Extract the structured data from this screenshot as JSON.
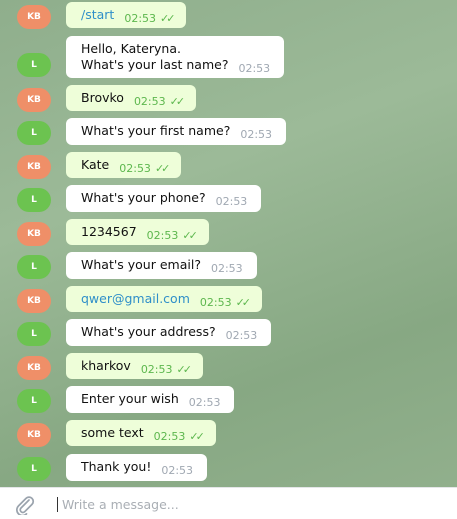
{
  "messages": [
    {
      "from": "user",
      "avatar": "KB",
      "text": "/start",
      "time": "02:53",
      "link": true,
      "ticks": "✓✓"
    },
    {
      "from": "bot",
      "avatar": "L",
      "lines": [
        "Hello, Kateryna.",
        "What's your last name?"
      ],
      "time": "02:53"
    },
    {
      "from": "user",
      "avatar": "KB",
      "text": "Brovko",
      "time": "02:53",
      "ticks": "✓✓"
    },
    {
      "from": "bot",
      "avatar": "L",
      "text": "What's your first name?",
      "time": "02:53"
    },
    {
      "from": "user",
      "avatar": "KB",
      "text": "Kate",
      "time": "02:53",
      "ticks": "✓✓"
    },
    {
      "from": "bot",
      "avatar": "L",
      "text": "What's your phone?",
      "time": "02:53"
    },
    {
      "from": "user",
      "avatar": "KB",
      "text": "1234567",
      "time": "02:53",
      "ticks": "✓✓"
    },
    {
      "from": "bot",
      "avatar": "L",
      "text": "What's your email?",
      "time": "02:53"
    },
    {
      "from": "user",
      "avatar": "KB",
      "text": "qwer@gmail.com",
      "time": "02:53",
      "link": true,
      "ticks": "✓✓"
    },
    {
      "from": "bot",
      "avatar": "L",
      "text": "What's your address?",
      "time": "02:53"
    },
    {
      "from": "user",
      "avatar": "KB",
      "text": "kharkov",
      "time": "02:53",
      "ticks": "✓✓"
    },
    {
      "from": "bot",
      "avatar": "L",
      "text": "Enter your wish",
      "time": "02:53"
    },
    {
      "from": "user",
      "avatar": "KB",
      "text": "some text",
      "time": "02:53",
      "ticks": "✓✓"
    },
    {
      "from": "bot",
      "avatar": "L",
      "text": "Thank you!",
      "time": "02:53"
    }
  ],
  "composer": {
    "placeholder": "Write a message...",
    "attach_icon": "paperclip-icon"
  },
  "colors": {
    "user_avatar": "#ef8f68",
    "bot_avatar": "#6cc350",
    "out_bubble": "#eefed9",
    "in_bubble": "#ffffff",
    "time_out": "#5db74e",
    "link": "#2f8fc9"
  }
}
